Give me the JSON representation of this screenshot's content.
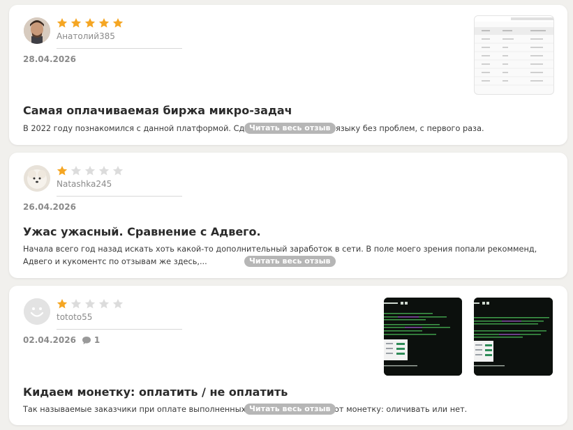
{
  "reviews": [
    {
      "author": "Анатолий385",
      "rating": 5,
      "date": "28.04.2026",
      "title": "Самая оплачиваемая биржа микро-задач",
      "snippet": "В 2022 году познакомился с данной платформой. Сда",
      "snippet_tail": "языку без проблем, с первого раза.",
      "read_more": "Читать весь отзыв",
      "avatar": "photo-man",
      "attachments": [
        "table-screenshot"
      ]
    },
    {
      "author": "Natashka245",
      "rating": 1,
      "date": "26.04.2026",
      "title": "Ужас ужасный. Сравнение с Адвего.",
      "snippet": "Начала всего год назад искать хоть какой-то дополнительный заработок в сети. В поле моего зрения попали рекомменд, Адвего и кукоментс по отзывам же здесь,...",
      "read_more": "Читать весь отзыв",
      "avatar": "photo-dog",
      "attachments": []
    },
    {
      "author": "tototo55",
      "rating": 1,
      "date": "02.04.2026",
      "comment_count": "1",
      "title": "Кидаем монетку: оплатить / не оплатить",
      "snippet": "Так называемые заказчики при оплате выполненных",
      "snippet_tail": "от монетку: оличивать или нет.",
      "read_more": "Читать весь отзыв",
      "avatar": "default-smiley",
      "attachments": [
        "terminal-screenshot",
        "terminal-screenshot"
      ]
    }
  ],
  "colors": {
    "star_on": "#f5a623",
    "star_off": "#dcdcdc",
    "read_more_bg": "#b6b6b6"
  }
}
